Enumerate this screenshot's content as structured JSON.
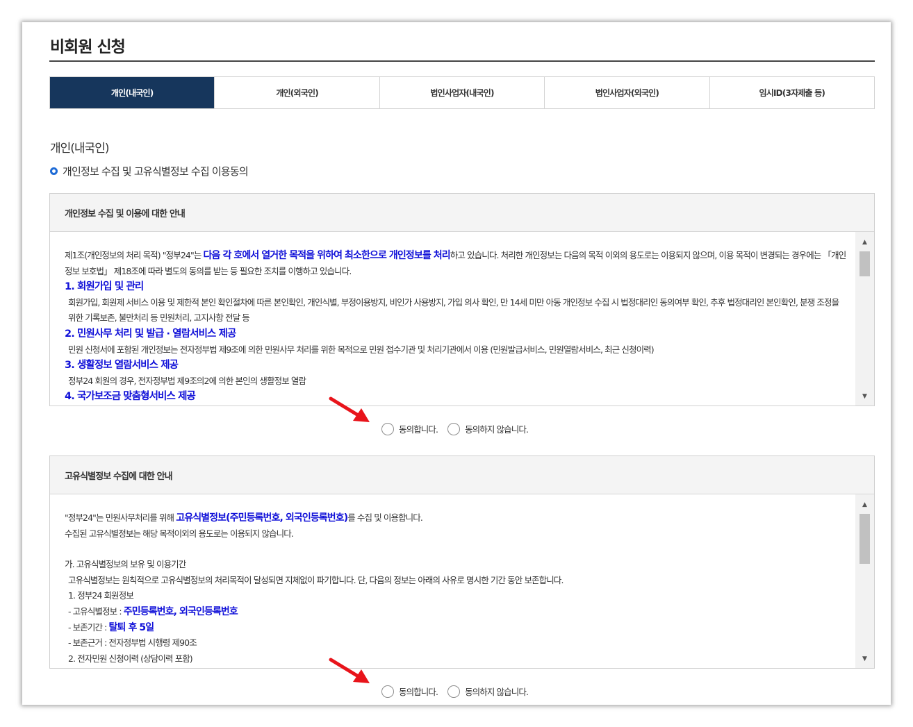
{
  "page": {
    "title": "비회원 신청"
  },
  "tabs": [
    {
      "label": "개인(내국인)",
      "active": true
    },
    {
      "label": "개인(외국인)",
      "active": false
    },
    {
      "label": "법인사업자(내국인)",
      "active": false
    },
    {
      "label": "법인사업자(외국인)",
      "active": false
    },
    {
      "label": "임시ID(3자제출 등)",
      "active": false
    }
  ],
  "section": {
    "title": "개인(내국인)",
    "subheading": "개인정보 수집 및 고유식별정보 수집 이용동의"
  },
  "privacy_box": {
    "header": "개인정보 수집 및 이용에 대한 안내",
    "intro_a": "제1조(개인정보의 처리 목적) \"정부24\"는 ",
    "intro_b": "다음 각 호에서 열거한 목적을 위하여 최소한으로 개인정보를 처리",
    "intro_c": "하고 있습니다. 처리한 개인정보는 다음의 목적 이외의 용도로는 이용되지 않으며, 이용 목적이 변경되는 경우에는 「개인정보 보호법」 제18조에 따라 별도의 동의를 받는 등 필요한 조치를 이행하고 있습니다.",
    "items": [
      {
        "heading": "1. 회원가입 및 관리",
        "text": "회원가입, 회원제 서비스 이용 및 제한적 본인 확인절차에 따른 본인확인, 개인식별, 부정이용방지, 비인가 사용방지, 가입 의사 확인, 만 14세 미만 아동 개인정보 수집 시 법정대리인 동의여부 확인, 추후 법정대리인 본인확인, 분쟁 조정을 위한 기록보존, 불만처리 등 민원처리, 고지사항 전달 등"
      },
      {
        "heading": "2. 민원사무 처리 및 발급 · 열람서비스 제공",
        "text": "민원 신청서에 포함된 개인정보는 전자정부법 제9조에 의한 민원사무 처리를 위한 목적으로 민원 접수기관 및 처리기관에서 이용 (민원발급서비스, 민원열람서비스, 최근 신청이력)"
      },
      {
        "heading": "3. 생활정보 열람서비스 제공",
        "text": "정부24 회원의 경우, 전자정부법 제9조의2에 의한 본인의 생활정보 열람"
      },
      {
        "heading": "4. 국가보조금 맞춤형서비스 제공",
        "text": ""
      }
    ],
    "agree_label": "동의합니다.",
    "disagree_label": "동의하지 않습니다."
  },
  "unique_box": {
    "header": "고유식별정보 수집에 대한 안내",
    "line1_a": "\"정부24\"는 민원사무처리를 위해 ",
    "line1_b": "고유식별정보(주민등록번호, 외국인등록번호)",
    "line1_c": "를 수집 및 이용합니다.",
    "line2": "수집된 고유식별정보는 해당 목적이외의 용도로는 이용되지 않습니다.",
    "sub_a": "가. 고유식별정보의 보유 및 이용기간",
    "sub_a_text": "고유식별정보는 원칙적으로 고유식별정보의 처리목적이 달성되면 지체없이 파기합니다. 단, 다음의 정보는 아래의 사유로 명시한 기간 동안 보존합니다.",
    "item1": "1. 정부24 회원정보",
    "item1_a_label": "- 고유식별정보 : ",
    "item1_a_value": "주민등록번호, 외국인등록번호",
    "item1_b_label": "- 보존기간 : ",
    "item1_b_value": "탈퇴 후 5일",
    "item1_c": "- 보존근거 : 전자정부법 시행령 제90조",
    "item2": "2. 전자민원 신청이력 (상담이력 포함)",
    "agree_label": "동의합니다.",
    "disagree_label": "동의하지 않습니다."
  },
  "colors": {
    "tab_active": "#16365c",
    "highlight": "#1010d8",
    "bullet": "#1e6bd6",
    "arrow": "#e8141b"
  },
  "icons": [
    "scroll-up-arrow-icon",
    "scroll-down-arrow-icon",
    "red-arrow-annotation-icon",
    "bullet-ring-icon"
  ]
}
